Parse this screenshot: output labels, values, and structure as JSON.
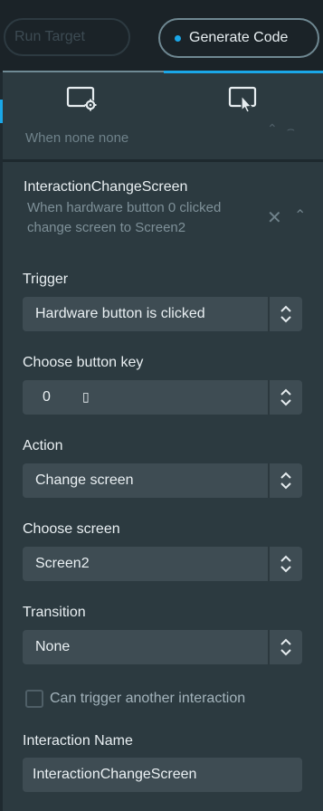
{
  "toolbar": {
    "run_target_label": "Run Target",
    "generate_code_label": "Generate Code",
    "accent": "#1aa7e8"
  },
  "tabs": [
    {
      "icon": "screen-settings-icon",
      "active": false
    },
    {
      "icon": "interaction-icon",
      "active": true
    }
  ],
  "interactions": [
    {
      "description": "When none none"
    },
    {
      "title": "InteractionChangeScreen",
      "description": "When hardware button 0 clicked change screen to Screen2"
    }
  ],
  "form": {
    "trigger_label": "Trigger",
    "trigger_value": "Hardware button is clicked",
    "button_key_label": "Choose button key",
    "button_key_value": "0",
    "button_key_glyph": "▯",
    "action_label": "Action",
    "action_value": "Change screen",
    "screen_label": "Choose screen",
    "screen_value": "Screen2",
    "transition_label": "Transition",
    "transition_value": "None",
    "chain_label": "Can trigger another interaction",
    "chain_checked": false,
    "name_label": "Interaction Name",
    "name_value": "InteractionChangeScreen"
  }
}
